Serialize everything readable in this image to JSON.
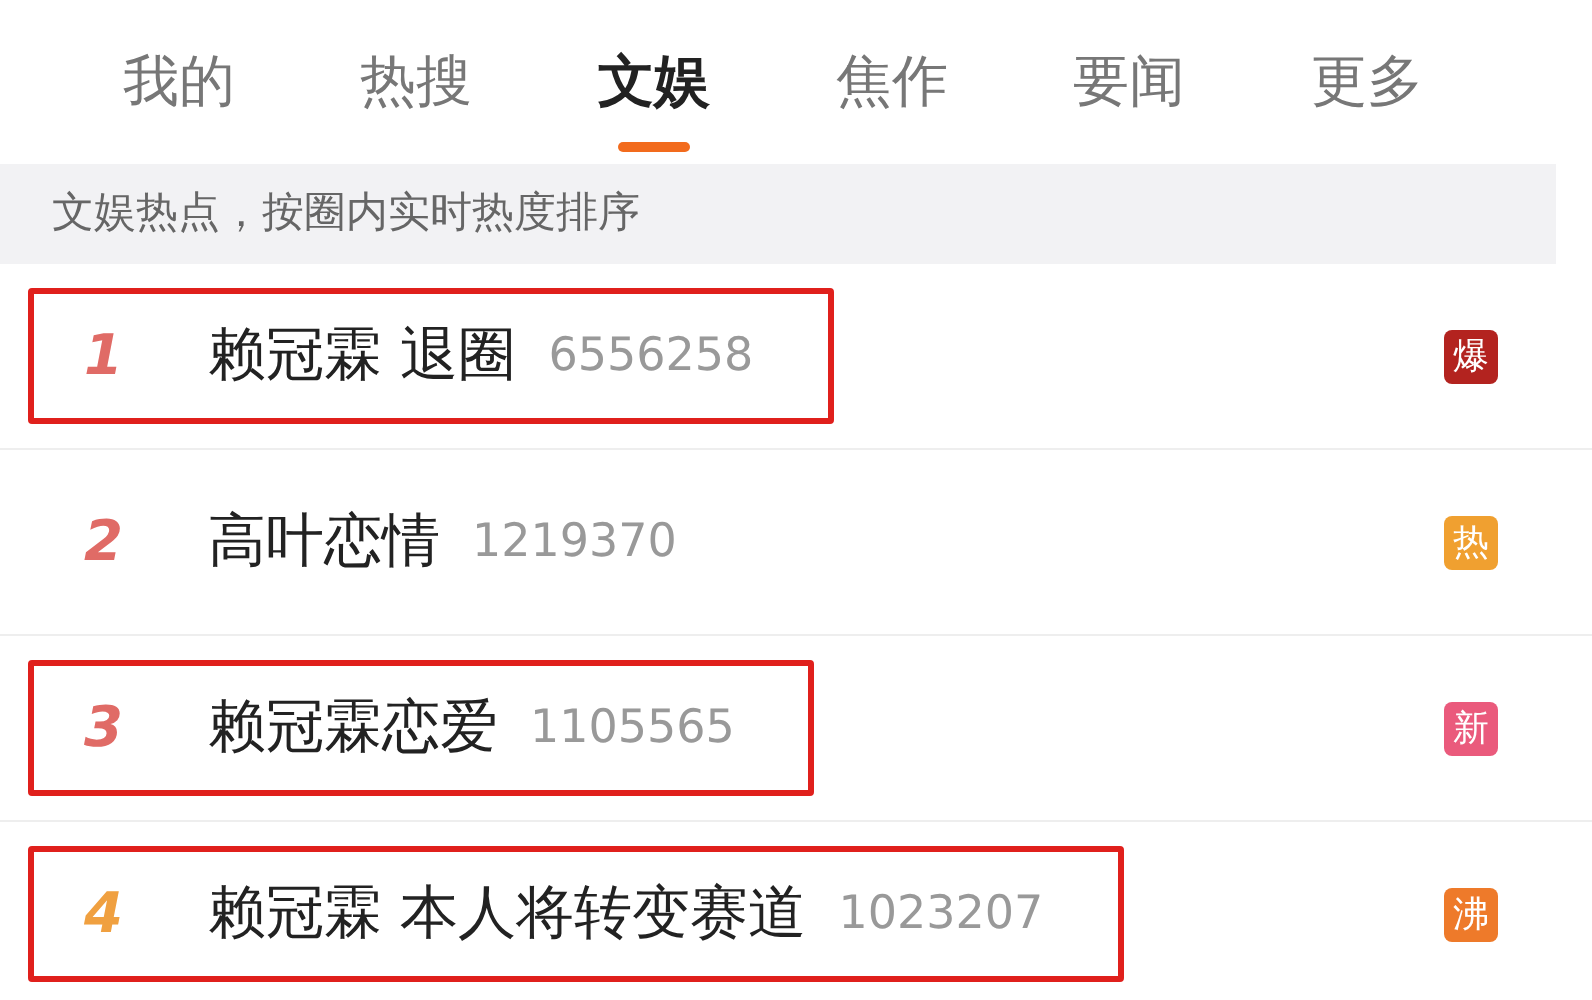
{
  "tabs": [
    {
      "label": "我的",
      "selected": false
    },
    {
      "label": "热搜",
      "selected": false
    },
    {
      "label": "文娱",
      "selected": true
    },
    {
      "label": "焦作",
      "selected": false
    },
    {
      "label": "要闻",
      "selected": false
    },
    {
      "label": "更多",
      "selected": false
    }
  ],
  "notice": "文娱热点，按圈内实时热度排序",
  "rows": [
    {
      "rank": {
        "text": "1",
        "color": "#e06b66"
      },
      "title": "赖冠霖 退圈",
      "count": "6556258",
      "badge": {
        "text": "爆",
        "color": "#b3231f"
      },
      "highlighted": true
    },
    {
      "rank": {
        "text": "2",
        "color": "#e06b66"
      },
      "title": "高叶恋情",
      "count": "1219370",
      "badge": {
        "text": "热",
        "color": "#f0a030"
      },
      "highlighted": false
    },
    {
      "rank": {
        "text": "3",
        "color": "#e06b66"
      },
      "title": "赖冠霖恋爱",
      "count": "1105565",
      "badge": {
        "text": "新",
        "color": "#ea5a7c"
      },
      "highlighted": true
    },
    {
      "rank": {
        "text": "4",
        "color": "#f0a040"
      },
      "title": "赖冠霖 本人将转变赛道",
      "count": "1023207",
      "badge": {
        "text": "沸",
        "color": "#ee7a2a"
      },
      "highlighted": true
    }
  ]
}
